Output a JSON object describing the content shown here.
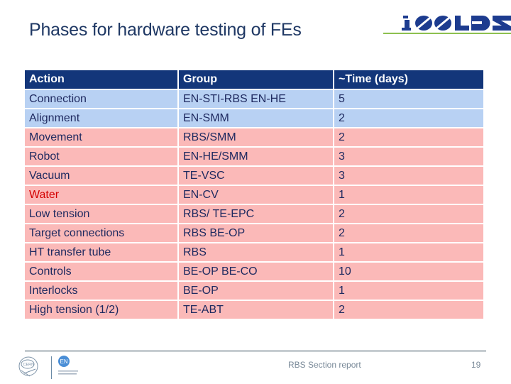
{
  "slide": {
    "title": "Phases for hardware testing of FEs",
    "logo_text": "ISOLDE",
    "colors": {
      "title": "#1f3864",
      "header_bg": "#13367a",
      "row_blue": "#b8d1f3",
      "row_pink": "#fbb9b8",
      "accent_green": "#8dc04f",
      "highlight_red": "#d40000"
    }
  },
  "table": {
    "headers": [
      "Action",
      "Group",
      "~Time (days)"
    ],
    "rows": [
      {
        "action": "Connection",
        "group": "EN-STI-RBS EN-HE",
        "time": "5",
        "color": "blue"
      },
      {
        "action": "Alignment",
        "group": "EN-SMM",
        "time": "2",
        "color": "blue"
      },
      {
        "action": "Movement",
        "group": "RBS/SMM",
        "time": "2",
        "color": "pink"
      },
      {
        "action": "Robot",
        "group": "EN-HE/SMM",
        "time": "3",
        "color": "pink"
      },
      {
        "action": "Vacuum",
        "group": "TE-VSC",
        "time": "3",
        "color": "pink"
      },
      {
        "action": "Water",
        "group": "EN-CV",
        "time": "1",
        "color": "pink",
        "highlight": true
      },
      {
        "action": "Low tension",
        "group": "RBS/ TE-EPC",
        "time": "2",
        "color": "pink"
      },
      {
        "action": "Target connections",
        "group": "RBS BE-OP",
        "time": "2",
        "color": "pink"
      },
      {
        "action": "HT transfer tube",
        "group": "RBS",
        "time": "1",
        "color": "pink"
      },
      {
        "action": "Controls",
        "group": "BE-OP BE-CO",
        "time": "10",
        "color": "pink"
      },
      {
        "action": "Interlocks",
        "group": "BE-OP",
        "time": "1",
        "color": "pink"
      },
      {
        "action": "High tension (1/2)",
        "group": "TE-ABT",
        "time": "2",
        "color": "pink"
      }
    ]
  },
  "footer": {
    "text": "RBS Section report",
    "page_number": "19",
    "cern_logo_text": "CERN",
    "en_logo_text": "EN",
    "en_department_text": "ENGINEERING DEPARTMENT"
  }
}
